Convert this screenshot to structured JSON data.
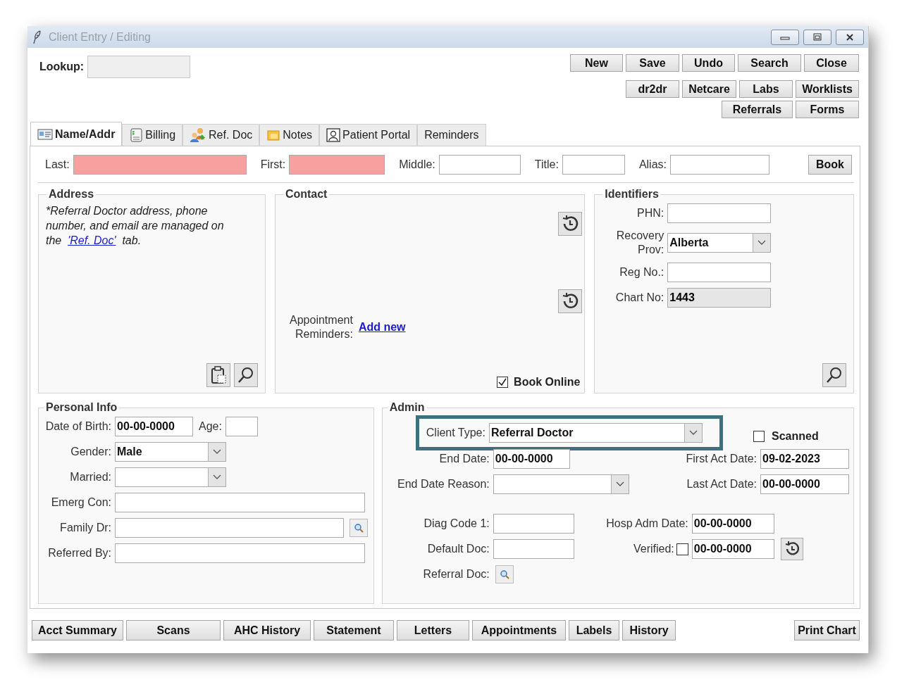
{
  "window": {
    "title": "Client Entry / Editing"
  },
  "lookup": {
    "label": "Lookup:"
  },
  "toolbar_rows": [
    [
      "New",
      "Save",
      "Undo",
      "Search",
      "Close"
    ],
    [
      "dr2dr",
      "Netcare",
      "Labs",
      "Worklists"
    ],
    [
      "Referrals",
      "Forms"
    ]
  ],
  "tabs": [
    {
      "label": "Name/Addr",
      "selected": true
    },
    {
      "label": "Billing",
      "selected": false
    },
    {
      "label": "Ref. Doc",
      "selected": false
    },
    {
      "label": "Notes",
      "selected": false
    },
    {
      "label": "Patient Portal",
      "selected": false
    },
    {
      "label": "Reminders",
      "selected": false
    }
  ],
  "name_row": {
    "fields": [
      {
        "label": "Last:",
        "required": true
      },
      {
        "label": "First:",
        "required": true
      },
      {
        "label": "Middle:",
        "required": false
      },
      {
        "label": "Title:",
        "required": false
      },
      {
        "label": "Alias:",
        "required": false
      }
    ],
    "button": "Book"
  },
  "address": {
    "legend": "Address",
    "note": "*Referral Doctor address, phone number, and email are managed on the",
    "link": "'Ref. Doc'",
    "note_end": "tab."
  },
  "contact": {
    "legend": "Contact",
    "reminders_label": "Appointment Reminders:",
    "add_link": "Add new",
    "book_online": {
      "label": "Book Online",
      "checked": true
    }
  },
  "identifiers": {
    "legend": "Identifiers",
    "fields": [
      {
        "label": "PHN:",
        "kind": "text",
        "disabled": false
      },
      {
        "label": "Recovery Prov:",
        "kind": "select",
        "value": "Alberta"
      },
      {
        "label": "Reg No.:",
        "kind": "text",
        "disabled": false
      },
      {
        "label": "Chart No:",
        "kind": "text",
        "value": "1443",
        "disabled": true
      }
    ]
  },
  "personal_info": {
    "legend": "Personal Info",
    "dob": {
      "label": "Date of Birth:",
      "value": "00-00-0000"
    },
    "age": {
      "label": "Age:"
    },
    "fields": [
      {
        "label": "Gender:",
        "kind": "select",
        "value": "Male"
      },
      {
        "label": "Married:",
        "kind": "select"
      },
      {
        "label": "Emerg Con:",
        "kind": "text"
      },
      {
        "label": "Family Dr:",
        "kind": "lookup"
      },
      {
        "label": "Referred By:",
        "kind": "text"
      }
    ]
  },
  "admin": {
    "legend": "Admin",
    "client_type": {
      "label": "Client Type:",
      "value": "Referral Doctor",
      "highlighted": true
    },
    "scanned": {
      "label": "Scanned",
      "checked": false
    },
    "end_date": {
      "label": "End Date:",
      "value": "00-00-0000"
    },
    "first_act_date": {
      "label": "First Act Date:",
      "value": "09-02-2023"
    },
    "end_date_reason": {
      "label": "End Date Reason:"
    },
    "last_act_date": {
      "label": "Last Act Date:",
      "value": "00-00-0000"
    },
    "diag_code": {
      "label": "Diag Code 1:"
    },
    "hosp_adm_date": {
      "label": "Hosp Adm Date:",
      "value": "00-00-0000"
    },
    "default_doc": {
      "label": "Default Doc:"
    },
    "verified": {
      "label": "Verified:",
      "checked": false,
      "value": "00-00-0000"
    },
    "referral_doc": {
      "label": "Referral Doc:"
    }
  },
  "bottom_buttons": [
    "Acct Summary",
    "Scans",
    "AHC History",
    "Statement",
    "Letters",
    "Appointments",
    "Labels",
    "History"
  ],
  "print_button": "Print Chart"
}
